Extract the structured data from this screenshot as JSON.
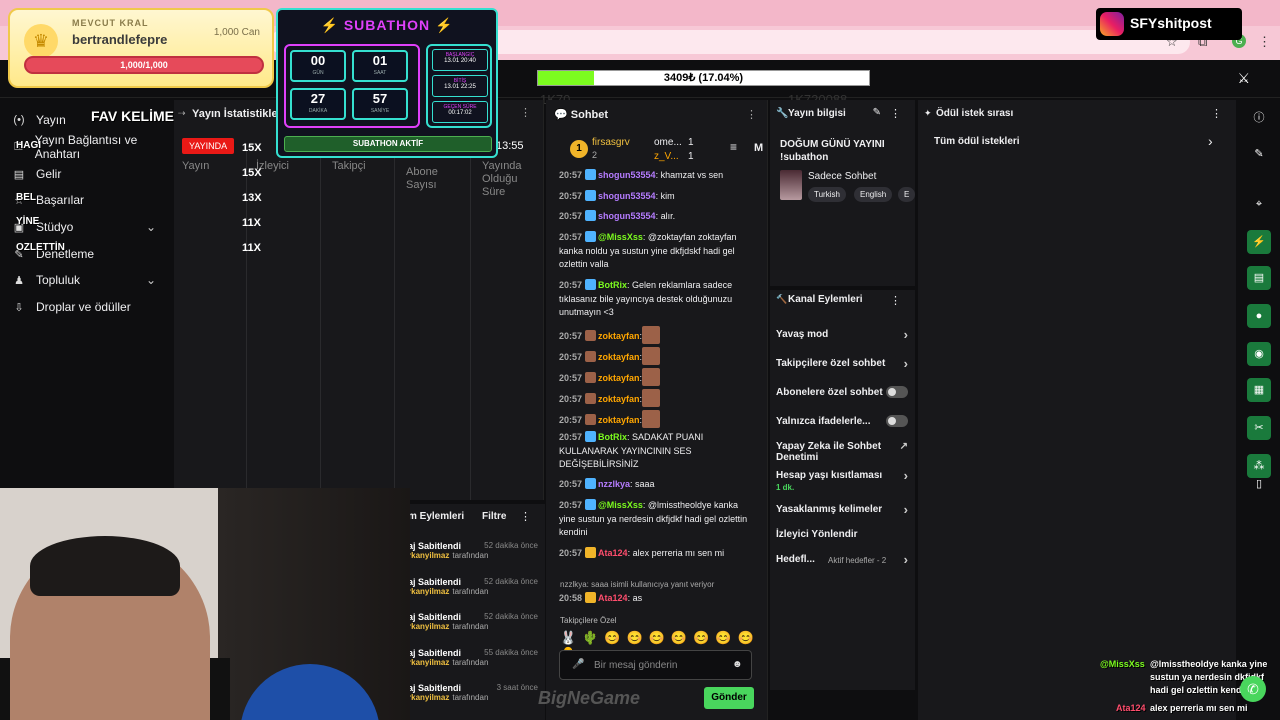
{
  "overlay": {
    "kral": {
      "label": "MEVCUT KRAL",
      "name": "bertrandlefepre",
      "can": "1,000 Can",
      "bar": "1,000/1,000"
    },
    "subathon": {
      "title": "SUBATHON",
      "timer": [
        {
          "n": "00",
          "u": "GÜN"
        },
        {
          "n": "01",
          "u": "SAAT"
        },
        {
          "n": "27",
          "u": "DAKİKA"
        },
        {
          "n": "57",
          "u": "SANİYE"
        }
      ],
      "info": [
        {
          "h": "BAŞLANGIÇ",
          "v": "13.01 20:40"
        },
        {
          "h": "BİTİŞ",
          "v": "13.01 22:25"
        },
        {
          "h": "GEÇEN SÜRE",
          "v": "00:17:02"
        }
      ],
      "status": "SUBATHON AKTİF"
    },
    "progress": {
      "text": "3409₺ (17.04%)",
      "fraction": 0.1704
    },
    "instagram": "SFYshitpost",
    "fav_title": "FAV KELİMELER",
    "fav_side": [
      "HAGI",
      "BEL",
      "YİNE",
      "OZLETTİN"
    ],
    "fav_counts": [
      "15X",
      "15X",
      "13X",
      "11X",
      "11X"
    ],
    "brand": "BigNeGame",
    "stream_chat": [
      {
        "user": "@MissXss",
        "text": "@lmisstheoldye kanka yine sustun ya nerdesin dkfjdkf hadi gel ozlettin kendini"
      },
      {
        "user": "Ata124",
        "text": "alex perreria mı sen mi"
      }
    ],
    "ghost_left": "1K70",
    "ghost_right": "1K720088"
  },
  "nav": {
    "items": [
      {
        "icon": "(•)",
        "label": "Yayın"
      },
      {
        "icon": "⚿",
        "label": "Yayın Bağlantısı ve Anahtarı"
      },
      {
        "icon": "▤",
        "label": "Gelir"
      },
      {
        "icon": "☆",
        "label": "Başarılar"
      },
      {
        "icon": "▣",
        "label": "Stüdyo"
      },
      {
        "icon": "✎",
        "label": "Denetleme"
      },
      {
        "icon": "♟",
        "label": "Topluluk"
      },
      {
        "icon": "⇩",
        "label": "Droplar ve ödüller"
      }
    ]
  },
  "stats": {
    "title": "Yayın İstatistikleri",
    "live": "YAYINDA",
    "time": "13:55",
    "cols": [
      "Yayın",
      "İzleyici",
      "Takipçi",
      "Abone Sayısı",
      "Yayında Olduğu Süre"
    ]
  },
  "chat": {
    "title": "Sohbet",
    "top": [
      {
        "rank": "1",
        "name": "firsasgrv",
        "n": "2"
      },
      {
        "name": "ome...",
        "n": "1"
      },
      {
        "name": "z_V...",
        "n": "1"
      }
    ],
    "messages": [
      {
        "time": "20:57",
        "user": "shogun53554",
        "cls": "u1",
        "text": ": khamzat vs sen"
      },
      {
        "time": "20:57",
        "user": "shogun53554",
        "cls": "u1",
        "text": ": kim"
      },
      {
        "time": "20:57",
        "user": "shogun53554",
        "cls": "u1",
        "text": ": alır."
      },
      {
        "time": "20:57",
        "user": "@MissXss",
        "cls": "u4",
        "text": ": @zoktayfan zoktayfan kanka noldu ya sustun yine dkfjdskf hadi gel ozlettin valla"
      },
      {
        "time": "20:57",
        "user": "BotRix",
        "cls": "u4",
        "text": ": Gelen reklamlara sadece tıklasanız bile yayıncıya destek olduğunuzu unutmayın <3"
      },
      {
        "time": "20:57",
        "user": "zoktayfan",
        "cls": "u3",
        "text": ":"
      },
      {
        "time": "20:57",
        "user": "zoktayfan",
        "cls": "u3",
        "text": ":"
      },
      {
        "time": "20:57",
        "user": "zoktayfan",
        "cls": "u3",
        "text": ":"
      },
      {
        "time": "20:57",
        "user": "zoktayfan",
        "cls": "u3",
        "text": ":"
      },
      {
        "time": "20:57",
        "user": "zoktayfan",
        "cls": "u3",
        "text": ":"
      },
      {
        "time": "20:57",
        "user": "BotRix",
        "cls": "u4",
        "text": ": SADAKAT PUANI KULLANARAK YAYINCININ SES DEĞİŞEBİLİRSİNİZ"
      },
      {
        "time": "20:57",
        "user": "nzzlkya",
        "cls": "u1",
        "text": ": saaa"
      },
      {
        "time": "20:57",
        "user": "@MissXss",
        "cls": "u4",
        "text": ": @lmisstheoldye kanka yine sustun ya nerdesin dkfjdkf hadi gel ozlettin kendini"
      },
      {
        "time": "20:57",
        "user": "Ata124",
        "cls": "u6",
        "text": ": alex perreria mı sen mi"
      },
      {
        "time": "20:58",
        "user": "Ata124",
        "cls": "u6",
        "text": ": as"
      }
    ],
    "reply": "nzzlkya: saaa isimli kullanıcıya yanıt veriyor",
    "followers": "Takipçilere Özel",
    "placeholder": "Bir mesaj gönderin",
    "send": "Gönder",
    "filter_label": "M"
  },
  "info": {
    "title": "Yayın bilgisi",
    "stream_title": "DOĞUM GÜNÜ YAYINI !subathon",
    "category": "Sadece Sohbet",
    "tags": [
      "Turkish",
      "English",
      "E"
    ]
  },
  "kanal": {
    "title": "Kanal Eylemleri",
    "rows": [
      {
        "label": "Yavaş mod",
        "type": "arrow"
      },
      {
        "label": "Takipçilere özel sohbet",
        "type": "arrow"
      },
      {
        "label": "Abonelere özel sohbet",
        "type": "toggle"
      },
      {
        "label": "Yalnızca ifadelerle...",
        "type": "toggle"
      },
      {
        "label": "Yapay Zeka ile Sohbet Denetimi",
        "type": "ext"
      },
      {
        "label": "Hesap yaşı kısıtlaması",
        "sub": "1 dk.",
        "type": "arrow"
      },
      {
        "label": "Yasaklanmış kelimeler",
        "type": "arrow"
      },
      {
        "label": "İzleyici Yönlendir",
        "type": "none"
      },
      {
        "label": "Hedefl...",
        "sub2": "Aktif hedefler - 2",
        "type": "arrow"
      }
    ]
  },
  "reward": {
    "title": "Ödül istek sırası",
    "row": "Tüm ödül istekleri"
  },
  "mod": {
    "title": "m Eylemleri",
    "filter": "Filtre",
    "rows": [
      {
        "a": "aj Sabitlendi",
        "d": "52 dakika önce",
        "by": "rkanyilmaz",
        "tf": "tarafından"
      },
      {
        "a": "aj Sabitlendi",
        "d": "52 dakika önce",
        "by": "rkanyilmaz",
        "tf": "tarafından"
      },
      {
        "a": "aj Sabitlendi",
        "d": "52 dakika önce",
        "by": "rkanyilmaz",
        "tf": "tarafından"
      },
      {
        "a": "aj Sabitlendi",
        "d": "55 dakika önce",
        "by": "rkanyilmaz",
        "tf": "tarafından"
      },
      {
        "a": "aj Sabitlendi",
        "d": "3 saat önce",
        "by": "rkanyilmaz",
        "tf": "tarafından"
      }
    ]
  },
  "colors": {
    "accent": "#49d65d",
    "live": "#e91916",
    "subathon_pink": "#e040fb",
    "subathon_cyan": "#35e0d0"
  }
}
